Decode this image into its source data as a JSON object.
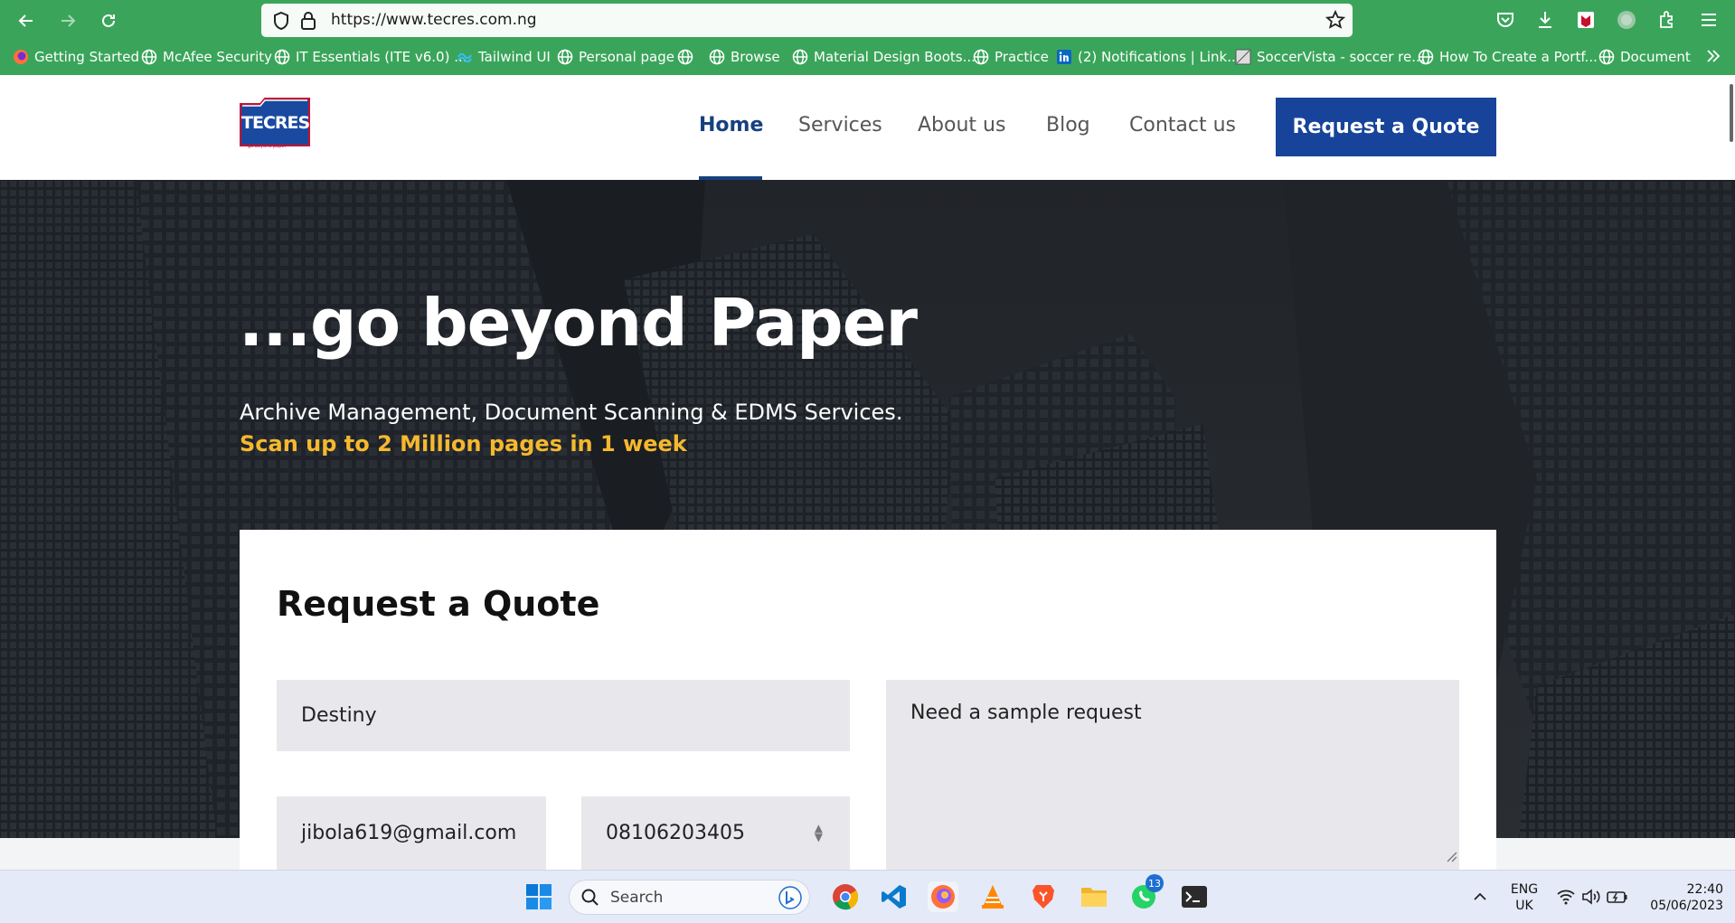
{
  "browser": {
    "url": "https://www.tecres.com.ng",
    "bookmarks": [
      "Getting Started",
      "McAfee Security",
      "IT Essentials (ITE v6.0) ...",
      "Tailwind UI",
      "Personal page",
      "Browse",
      "Material Design Boots...",
      "Practice",
      "(2) Notifications | Link...",
      "SoccerVista - soccer re...",
      "How To Create a Portf...",
      "Document"
    ]
  },
  "site": {
    "logo_text": "TECRES",
    "logo_tagline": "go beyond paper",
    "nav": [
      "Home",
      "Services",
      "About us",
      "Blog",
      "Contact us"
    ],
    "cta_label": "Request a Quote"
  },
  "hero": {
    "title": "...go beyond Paper",
    "subtitle": "Archive Management, Document Scanning & EDMS Services.",
    "highlight": "Scan up to 2 Million pages in 1 week"
  },
  "quote_form": {
    "title": "Request a Quote",
    "name_value": "Destiny",
    "email_value": "jibola619@gmail.com",
    "phone_value": "08106203405",
    "message_value": "Need a sample request"
  },
  "taskbar": {
    "search_label": "Search",
    "whatsapp_badge": "13",
    "lang_top": "ENG",
    "lang_bottom": "UK",
    "time": "22:40",
    "date": "05/06/2023"
  },
  "colors": {
    "browser_chrome": "#3aa55a",
    "brand_blue": "#17449a",
    "highlight_yellow": "#f5b82e"
  }
}
